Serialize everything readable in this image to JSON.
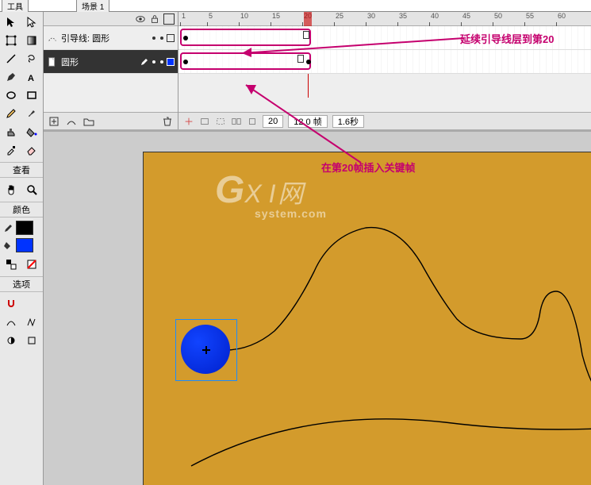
{
  "header": {
    "tools_title": "工具",
    "scene_tab": "场景 1"
  },
  "tools": {
    "sections": {
      "view": "查看",
      "color": "颜色",
      "options": "选项"
    },
    "fill_color": "#0033ff",
    "stroke_color": "#000000",
    "items": [
      {
        "name": "selection-tool"
      },
      {
        "name": "subselect-tool"
      },
      {
        "name": "free-transform-tool"
      },
      {
        "name": "gradient-transform-tool"
      },
      {
        "name": "line-tool"
      },
      {
        "name": "lasso-tool"
      },
      {
        "name": "pen-tool"
      },
      {
        "name": "text-tool"
      },
      {
        "name": "oval-tool"
      },
      {
        "name": "rectangle-tool"
      },
      {
        "name": "pencil-tool"
      },
      {
        "name": "brush-tool"
      },
      {
        "name": "ink-bottle-tool"
      },
      {
        "name": "paint-bucket-tool"
      },
      {
        "name": "eyedropper-tool"
      },
      {
        "name": "eraser-tool"
      }
    ],
    "view_items": [
      {
        "name": "hand-tool"
      },
      {
        "name": "zoom-tool"
      }
    ],
    "option_items": [
      {
        "name": "snap-tool"
      },
      {
        "name": "smooth-tool"
      },
      {
        "name": "straighten-tool"
      },
      {
        "name": "rotate-tool"
      },
      {
        "name": "option-a"
      },
      {
        "name": "option-b"
      }
    ]
  },
  "timeline": {
    "layers": [
      {
        "name": "引导线: 圆形",
        "selected": false,
        "icon": "guide"
      },
      {
        "name": "圆形",
        "selected": true,
        "icon": "page"
      }
    ],
    "ruler_marks": [
      1,
      5,
      10,
      15,
      20,
      25,
      30,
      35,
      40,
      45,
      50,
      55,
      60
    ],
    "current_frame": 20,
    "status": {
      "frame": "20",
      "fps": "12.0 帧",
      "time": "1.6秒"
    }
  },
  "annotations": {
    "top": "延续引导线层到第20",
    "bottom": "在第20帧插入关键帧"
  },
  "watermark": {
    "g": "G",
    "xi": "X I",
    "cn": "网",
    "domain": "system.com"
  }
}
